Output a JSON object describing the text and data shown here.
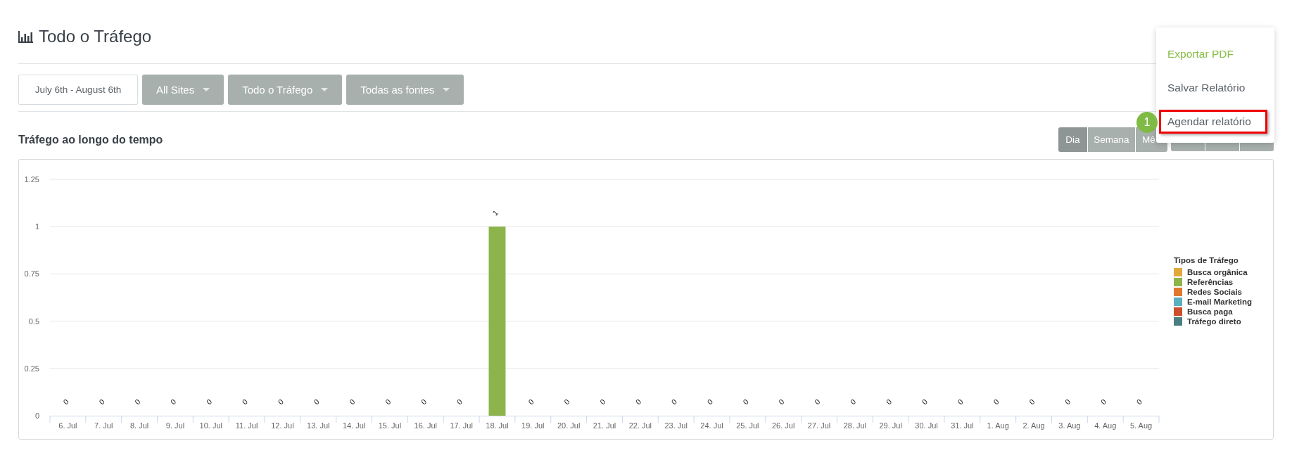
{
  "page_header": {
    "title": "Todo o Tráfego"
  },
  "filters": {
    "date_range": "July 6th - August 6th",
    "dropdowns": [
      "All Sites",
      "Todo o Tráfego",
      "Todas as fontes"
    ]
  },
  "export_menu": {
    "items": [
      {
        "label": "Exportar PDF",
        "highlighted": true,
        "outlined": false
      },
      {
        "label": "Salvar Relatório",
        "highlighted": false,
        "outlined": false
      },
      {
        "label": "Agendar relatório",
        "highlighted": false,
        "outlined": true,
        "step": "1"
      }
    ]
  },
  "traffic_chart": {
    "title": "Tráfego ao longo do tempo",
    "period_buttons": [
      {
        "label": "Dia",
        "selected": true
      },
      {
        "label": "Semana",
        "selected": false
      },
      {
        "label": "Mê",
        "selected": false
      }
    ],
    "legend": {
      "title": "Tipos de Tráfego"
    },
    "chart_data": {
      "type": "bar",
      "stacked": true,
      "grid": true,
      "ylim": [
        0,
        1.25
      ],
      "yticks": [
        0,
        0.25,
        0.5,
        0.75,
        1,
        1.25
      ],
      "categories": [
        "6. Jul",
        "7. Jul",
        "8. Jul",
        "9. Jul",
        "10. Jul",
        "11. Jul",
        "12. Jul",
        "13. Jul",
        "14. Jul",
        "15. Jul",
        "16. Jul",
        "17. Jul",
        "18. Jul",
        "19. Jul",
        "20. Jul",
        "21. Jul",
        "22. Jul",
        "23. Jul",
        "24. Jul",
        "25. Jul",
        "26. Jul",
        "27. Jul",
        "28. Jul",
        "29. Jul",
        "30. Jul",
        "31. Jul",
        "1. Aug",
        "2. Aug",
        "3. Aug",
        "4. Aug",
        "5. Aug"
      ],
      "series": [
        {
          "name": "Busca orgânica",
          "color": "#e3a83b",
          "values": [
            0,
            0,
            0,
            0,
            0,
            0,
            0,
            0,
            0,
            0,
            0,
            0,
            0,
            0,
            0,
            0,
            0,
            0,
            0,
            0,
            0,
            0,
            0,
            0,
            0,
            0,
            0,
            0,
            0,
            0,
            0
          ]
        },
        {
          "name": "Referências",
          "color": "#8cb44b",
          "values": [
            0,
            0,
            0,
            0,
            0,
            0,
            0,
            0,
            0,
            0,
            0,
            0,
            1,
            0,
            0,
            0,
            0,
            0,
            0,
            0,
            0,
            0,
            0,
            0,
            0,
            0,
            0,
            0,
            0,
            0,
            0
          ],
          "value_labels": [
            "0",
            "0",
            "0",
            "0",
            "0",
            "0",
            "0",
            "0",
            "0",
            "0",
            "0",
            "0",
            "1",
            "0",
            "0",
            "0",
            "0",
            "0",
            "0",
            "0",
            "0",
            "0",
            "0",
            "0",
            "0",
            "0",
            "0",
            "0",
            "0",
            "0",
            "0"
          ]
        },
        {
          "name": "Redes Sociais",
          "color": "#e0782f",
          "values": [
            0,
            0,
            0,
            0,
            0,
            0,
            0,
            0,
            0,
            0,
            0,
            0,
            0,
            0,
            0,
            0,
            0,
            0,
            0,
            0,
            0,
            0,
            0,
            0,
            0,
            0,
            0,
            0,
            0,
            0,
            0
          ]
        },
        {
          "name": "E-mail Marketing",
          "color": "#5aafc0",
          "values": [
            0,
            0,
            0,
            0,
            0,
            0,
            0,
            0,
            0,
            0,
            0,
            0,
            0,
            0,
            0,
            0,
            0,
            0,
            0,
            0,
            0,
            0,
            0,
            0,
            0,
            0,
            0,
            0,
            0,
            0,
            0
          ]
        },
        {
          "name": "Busca paga",
          "color": "#cc4e2a",
          "values": [
            0,
            0,
            0,
            0,
            0,
            0,
            0,
            0,
            0,
            0,
            0,
            0,
            0,
            0,
            0,
            0,
            0,
            0,
            0,
            0,
            0,
            0,
            0,
            0,
            0,
            0,
            0,
            0,
            0,
            0,
            0
          ]
        },
        {
          "name": "Tráfego direto",
          "color": "#4a7f7f",
          "values": [
            0,
            0,
            0,
            0,
            0,
            0,
            0,
            0,
            0,
            0,
            0,
            0,
            0,
            0,
            0,
            0,
            0,
            0,
            0,
            0,
            0,
            0,
            0,
            0,
            0,
            0,
            0,
            0,
            0,
            0,
            0
          ]
        }
      ]
    }
  }
}
